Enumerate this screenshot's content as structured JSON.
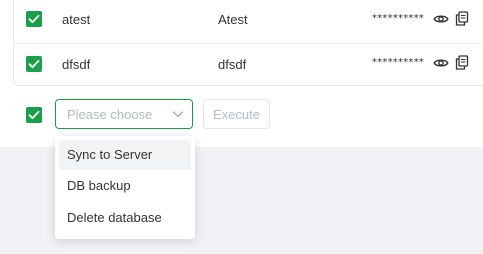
{
  "table": {
    "rows": [
      {
        "name": "atest",
        "display_name": "Atest",
        "password": "**********",
        "checked": true
      },
      {
        "name": "dfsdf",
        "display_name": "dfsdf",
        "password": "**********",
        "checked": true
      }
    ]
  },
  "action_bar": {
    "select_placeholder": "Please choose",
    "execute_label": "Execute",
    "checked": true
  },
  "dropdown": {
    "options": [
      "Sync to Server",
      "DB backup",
      "Delete database"
    ],
    "highlighted_index": 0
  },
  "colors": {
    "accent": "#1aa04a",
    "background": "#f0f2f5",
    "placeholder": "#b4b8bf"
  },
  "icons": {
    "show_password": "eye-icon",
    "copy": "copy-icon",
    "check": "check-icon",
    "select_arrow": "chevron-down-icon"
  }
}
